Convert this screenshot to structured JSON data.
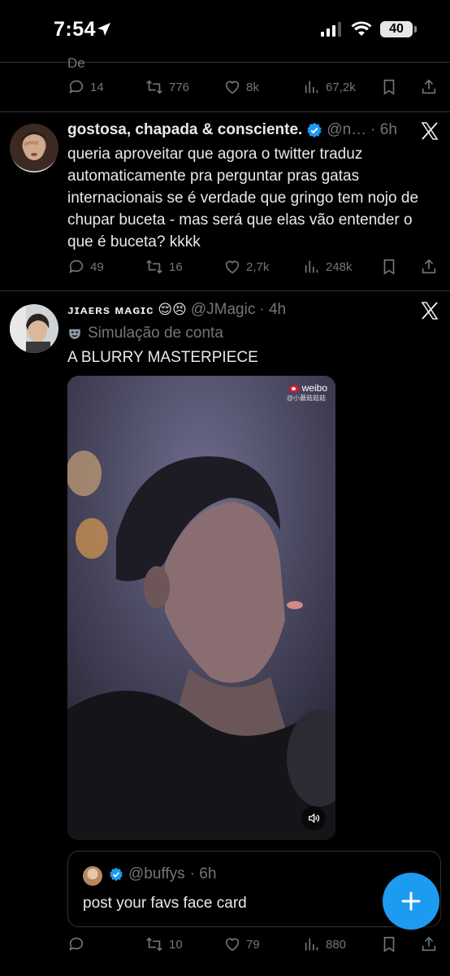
{
  "status_bar": {
    "time": "7:54",
    "battery": "40"
  },
  "top_tweet_partial": {
    "text_fragment": "De",
    "actions": {
      "replies": "14",
      "retweets": "776",
      "likes": "8k",
      "views": "67,2k"
    }
  },
  "tweet1": {
    "display_name": "gostosa, chapada & consciente.",
    "handle": "@n…",
    "time": "· 6h",
    "text": "queria aproveitar que agora o twitter traduz automaticamente pra perguntar pras gatas internacionais se é verdade que gringo tem nojo de chupar buceta - mas será que elas vão entender o que é buceta? kkkk",
    "actions": {
      "replies": "49",
      "retweets": "16",
      "likes": "2,7k",
      "views": "248k"
    }
  },
  "tweet2": {
    "display_name": "ᴊɪᴀᴇʀs ᴍᴀɢɪᴄ",
    "emojis": "😌😣",
    "handle": "@JMagic",
    "time": "· 4h",
    "label": "Simulação de conta",
    "text": "A BLURRY MASTERPIECE",
    "media_watermark": "weibo",
    "media_watermark_sub": "@小蘑菇菇菇",
    "quote": {
      "handle": "@buffys",
      "time": "· 6h",
      "text": "post your favs face card"
    },
    "actions": {
      "replies": "",
      "retweets": "10",
      "likes": "79",
      "views": "880"
    }
  },
  "colors": {
    "accent": "#1d9bf0",
    "muted": "#71767b",
    "text": "#e7e9ea",
    "divider": "#2f3336"
  }
}
